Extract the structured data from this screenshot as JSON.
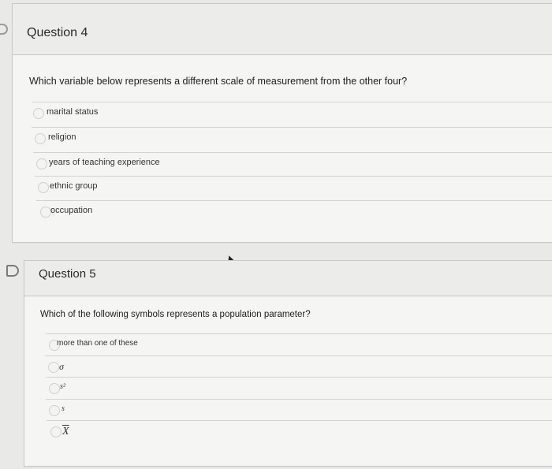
{
  "question4": {
    "title": "Question 4",
    "text": "Which variable below represents a different scale of measurement from the other four?",
    "options": [
      "marital status",
      "religion",
      "years of teaching experience",
      "ethnic group",
      "occupation"
    ]
  },
  "question5": {
    "title": "Question 5",
    "text": "Which of the following symbols represents a population parameter?",
    "options": [
      "more than one of these",
      "σ",
      "s²",
      "s",
      "X"
    ]
  }
}
